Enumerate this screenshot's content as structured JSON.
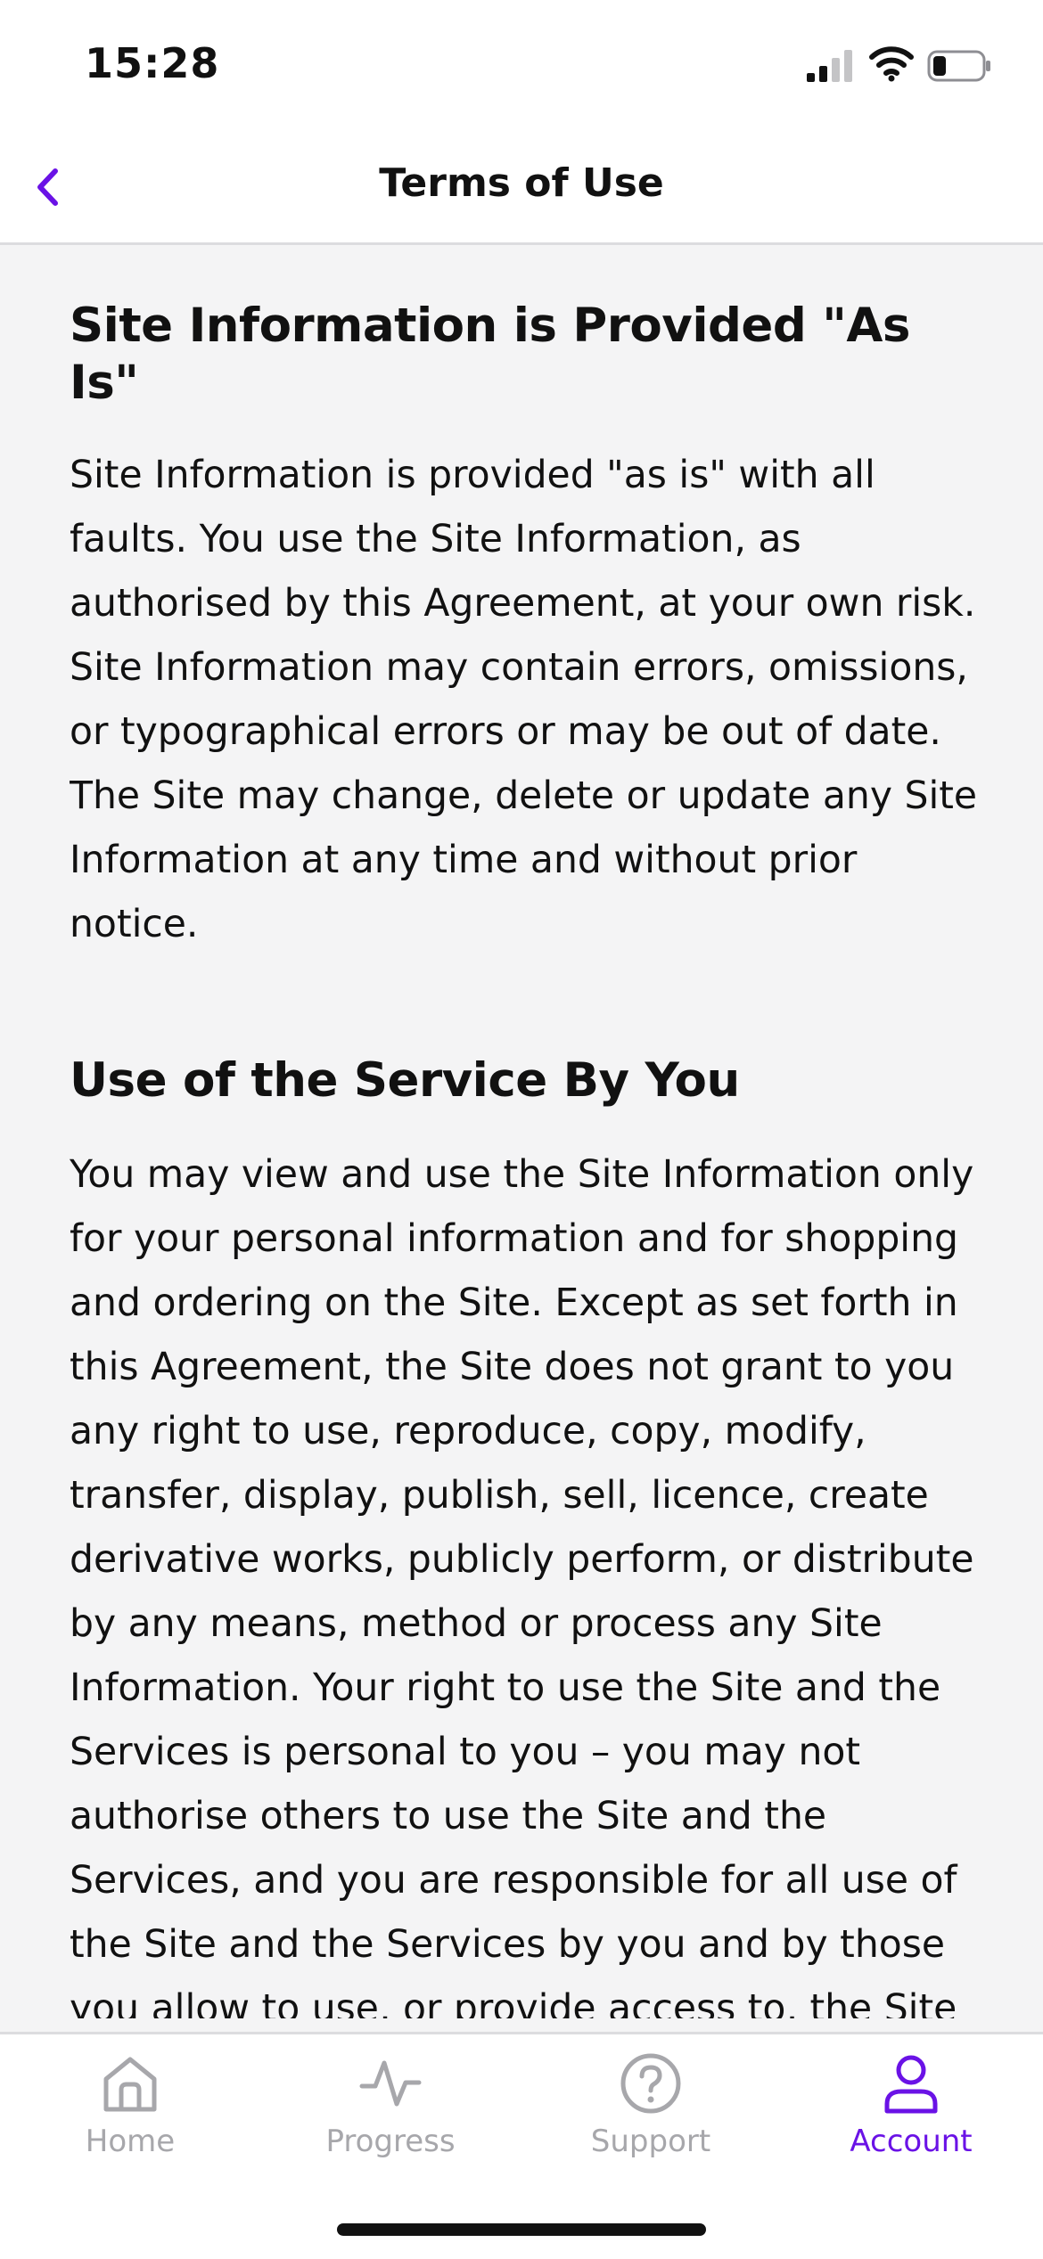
{
  "status_bar": {
    "time": "15:28",
    "icons": [
      "cellular-signal-icon",
      "wifi-icon",
      "battery-icon"
    ]
  },
  "header": {
    "title": "Terms of Use",
    "back_icon": "chevron-left-icon",
    "accent": "#6a12e6"
  },
  "sections": [
    {
      "heading": "Site Information is Provided \"As Is\"",
      "body": "Site Information is provided \"as is\" with all faults. You use the Site Information, as authorised by this Agreement, at your own risk. Site Information may contain errors, omissions, or typographical errors or may be out of date. The Site may change, delete or update any Site Information at any time and without prior notice."
    },
    {
      "heading": "Use of the Service By You",
      "body": "You may view and use the Site Information only for your personal information and for shopping and ordering on the Site. Except as set forth in this Agreement, the Site does not grant to you any right to use, reproduce, copy, modify, transfer, display, publish, sell, licence, create derivative works, publicly perform, or distribute by any means, method or process any Site Information. Your right to use the Site and the Services is personal to you – you may not authorise others to use the Site and the Services, and you are responsible for all use of the Site and the Services by you and by those you allow to use, or provide access to, the Site and the Services. You"
    }
  ],
  "tab_bar": {
    "tabs": [
      {
        "label": "Home",
        "icon": "home-icon",
        "active": false
      },
      {
        "label": "Progress",
        "icon": "activity-icon",
        "active": false
      },
      {
        "label": "Support",
        "icon": "help-circle-icon",
        "active": false
      },
      {
        "label": "Account",
        "icon": "user-icon",
        "active": true
      }
    ],
    "inactive_color": "#a7a7ab",
    "active_color": "#6a12e6"
  }
}
